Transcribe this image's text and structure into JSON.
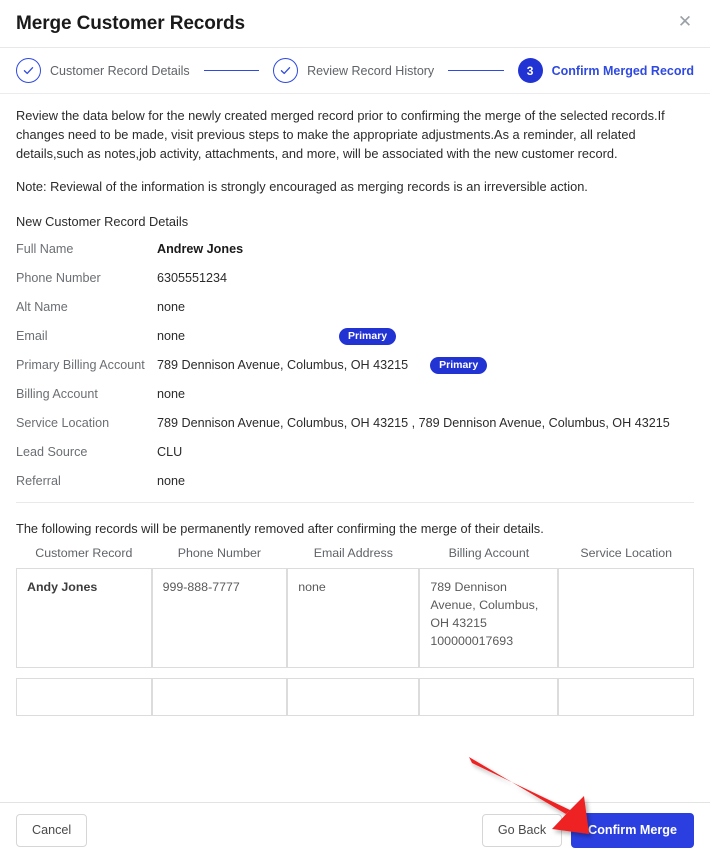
{
  "header": {
    "title": "Merge Customer Records",
    "close_label": "✕"
  },
  "stepper": {
    "steps": [
      {
        "label": "Customer Record Details",
        "state": "done",
        "marker": "check"
      },
      {
        "label": "Review Record History",
        "state": "done",
        "marker": "check"
      },
      {
        "label": "Confirm Merged Record",
        "state": "active",
        "marker": "3"
      }
    ]
  },
  "body": {
    "intro": "Review the data below for the newly created merged record prior to confirming the merge of the selected records.If changes need to be made, visit previous steps to make the appropriate adjustments.As a reminder, all related details,such as notes,job activity, attachments, and more, will be associated with the new customer record.",
    "note": "Note: Reviewal of the information is strongly encouraged as merging records is an irreversible action.",
    "section_heading": "New Customer Record Details",
    "badge_label": "Primary",
    "details": [
      {
        "label": "Full Name",
        "value": "Andrew Jones"
      },
      {
        "label": "Phone Number",
        "value": "6305551234"
      },
      {
        "label": "Alt Name",
        "value": "none"
      },
      {
        "label": "Email",
        "value": "none"
      },
      {
        "label": "Primary Billing Account",
        "value": "789 Dennison Avenue, Columbus, OH 43215"
      },
      {
        "label": "Billing Account",
        "value": "none"
      },
      {
        "label": "Service Location",
        "value": "789 Dennison Avenue, Columbus, OH 43215 , 789 Dennison Avenue, Columbus, OH 43215"
      },
      {
        "label": "Lead Source",
        "value": "CLU"
      },
      {
        "label": "Referral",
        "value": "none"
      }
    ]
  },
  "removed": {
    "caption": "The following records will be permanently removed after confirming the merge of their details.",
    "columns": [
      "Customer Record",
      "Phone Number",
      "Email Address",
      "Billing Account",
      "Service Location"
    ],
    "rows": [
      {
        "customer_record": "Andy Jones",
        "phone_number": "999-888-7777",
        "email_address": "none",
        "billing_account": "789 Dennison Avenue, Columbus, OH 43215 100000017693",
        "service_location": ""
      },
      {
        "customer_record": "",
        "phone_number": "",
        "email_address": "",
        "billing_account": "",
        "service_location": ""
      }
    ]
  },
  "footer": {
    "cancel_label": "Cancel",
    "go_back_label": "Go Back",
    "confirm_label": "Confirm Merge"
  },
  "colors": {
    "accent_blue": "#2b3fe0",
    "step_active": "#2233d4",
    "badge_blue": "#2233d4",
    "annotation_red": "#ee2020",
    "muted_text": "#6b6f73"
  }
}
